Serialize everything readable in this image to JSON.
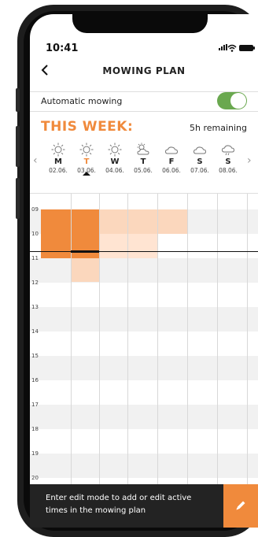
{
  "status_bar": {
    "time": "10:41"
  },
  "header": {
    "title": "MOWING PLAN",
    "back_icon": "chevron-left-icon"
  },
  "auto_mowing": {
    "label": "Automatic mowing",
    "enabled": true,
    "toggle_color": "#6aa84f"
  },
  "week": {
    "title": "THIS WEEK:",
    "remaining": "5h remaining"
  },
  "days": [
    {
      "letter": "M",
      "date": "02.06.",
      "weather": "sun-icon",
      "today": false
    },
    {
      "letter": "T",
      "date": "03.06.",
      "weather": "sun-icon",
      "today": true
    },
    {
      "letter": "W",
      "date": "04.06.",
      "weather": "sun-icon",
      "today": false
    },
    {
      "letter": "T",
      "date": "05.06.",
      "weather": "sun-cloud-icon",
      "today": false
    },
    {
      "letter": "F",
      "date": "06.06.",
      "weather": "cloud-icon",
      "today": false
    },
    {
      "letter": "S",
      "date": "07.06.",
      "weather": "cloud-icon",
      "today": false
    },
    {
      "letter": "S",
      "date": "08.06.",
      "weather": "rain-cloud-icon",
      "today": false
    }
  ],
  "hours": [
    "09",
    "10",
    "11",
    "12",
    "13",
    "14",
    "15",
    "16",
    "17",
    "18",
    "19",
    "20"
  ],
  "colors": {
    "accent": "#f08a3c",
    "planned": "#fbd7bd",
    "footer": "#232323"
  },
  "footer": {
    "text": "Enter edit mode to add or edit active times in the mowing plan",
    "edit_icon": "pencil-icon"
  }
}
